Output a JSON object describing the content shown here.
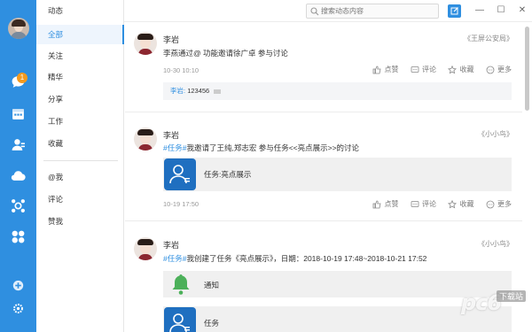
{
  "rail": {
    "badge_count": "1",
    "icons": [
      "chat-icon",
      "calendar-icon",
      "contacts-icon",
      "cloud-icon",
      "workflow-icon",
      "apps-icon",
      "add-icon",
      "settings-icon"
    ]
  },
  "categories": {
    "header": "动态",
    "items": [
      "全部",
      "关注",
      "精华",
      "分享",
      "工作",
      "收藏",
      "@我",
      "评论",
      "赞我"
    ],
    "active_index": 0
  },
  "topbar": {
    "search_placeholder": "搜索动态内容",
    "window_buttons": [
      "—",
      "☐",
      "✕"
    ]
  },
  "actions": {
    "like": "点赞",
    "comment": "评论",
    "favorite": "收藏",
    "more": "更多"
  },
  "posts": [
    {
      "author": "李岩",
      "tag": "《王屏公安局》",
      "text": "李燕通过@ 功能邀请徐广卓 参与讨论",
      "time": "10-30 10:10",
      "comment_author": "李岩:",
      "comment_text": "123456"
    },
    {
      "author": "李岩",
      "tag": "《小小鸟》",
      "text_highlight": "#任务#",
      "text": "我邀请了王纯,郑志宏 参与任务<<亮点展示>>的讨论",
      "card_label": "任务:亮点展示",
      "time": "10-19 17:50"
    },
    {
      "author": "李岩",
      "tag": "《小小鸟》",
      "text_highlight": "#任务#",
      "text": "我创建了任务《亮点展示》，日期：2018-10-19 17:48~2018-10-21 17:52",
      "notice_label": "通知",
      "card_label": "任务"
    }
  ],
  "watermark": {
    "text": "pc6",
    "sub": "下载站"
  },
  "colors": {
    "accent": "#2f8fe0",
    "badge": "#f39a1e",
    "task_icon": "#1f6fc0",
    "bell": "#4cb05a"
  }
}
